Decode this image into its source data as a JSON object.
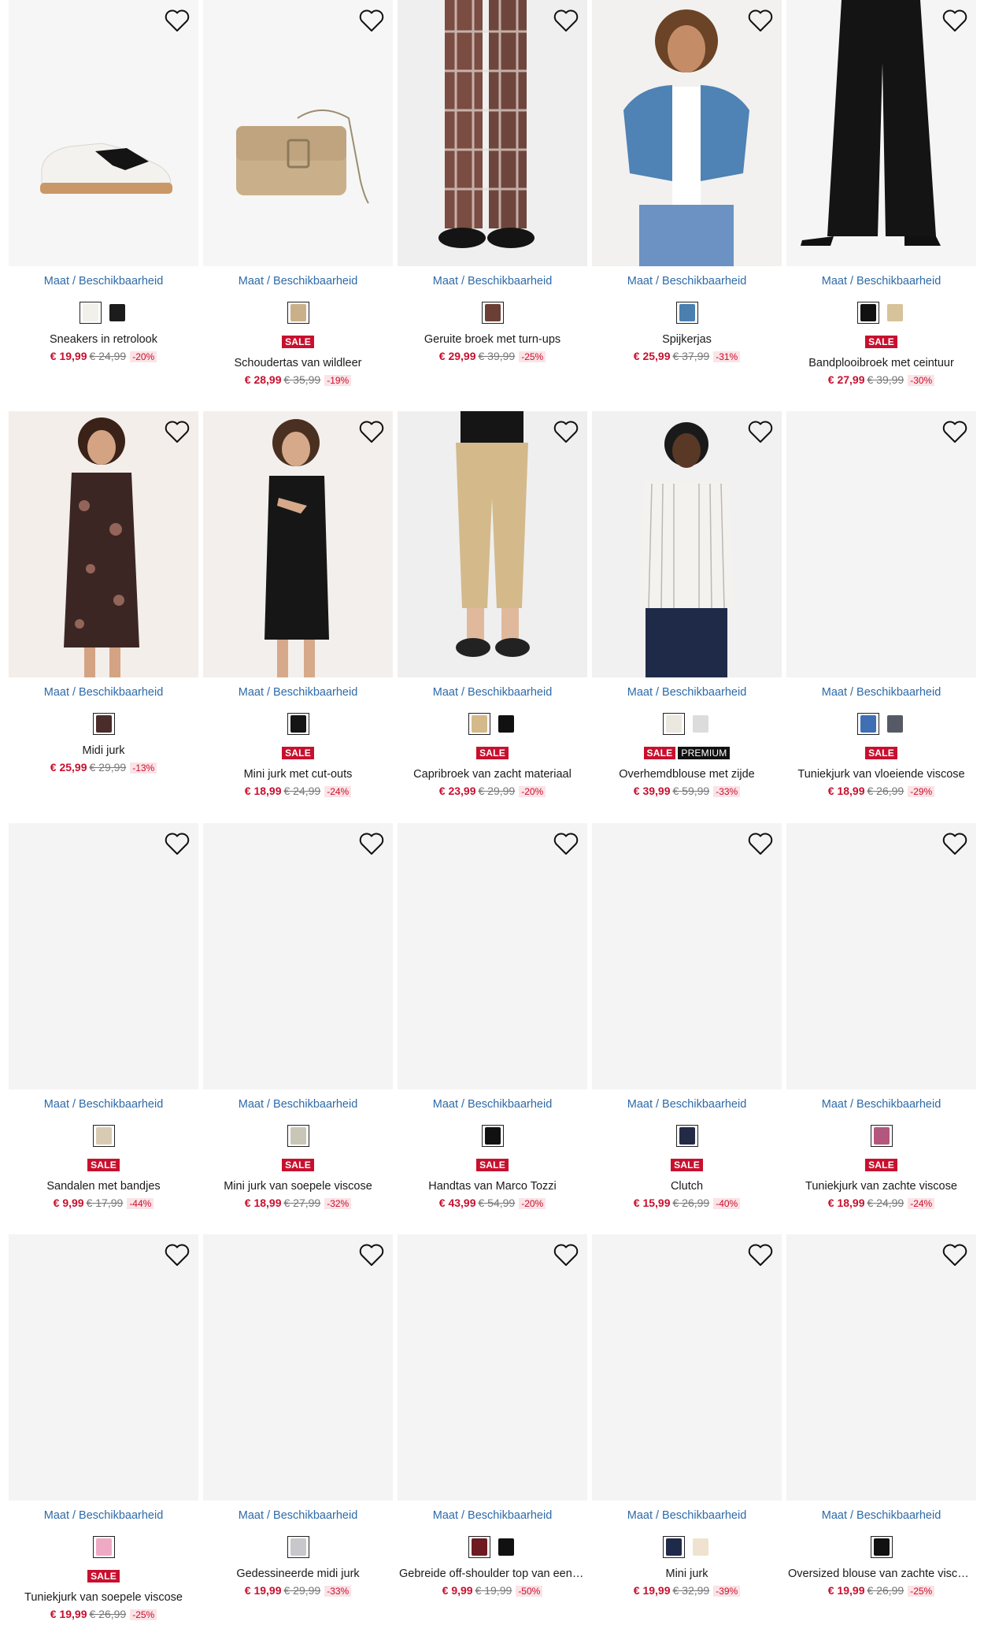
{
  "size_link_label": "Maat / Beschikbaarheid",
  "colors": {
    "price": "#c8102e",
    "link": "#2d6aa8",
    "sale_badge": "#c8102e",
    "premium_badge": "#111111",
    "image_bg": "#f4f4f4"
  },
  "products": [
    {
      "name": "Sneakers in retrolook",
      "price": "€ 19,99",
      "old_price": "€ 24,99",
      "discount": "-20%",
      "badges": [],
      "swatches": [
        "#f2f0ea",
        "#1c1c1c"
      ],
      "image": "sneaker"
    },
    {
      "name": "Schoudertas van wildleer",
      "price": "€ 28,99",
      "old_price": "€ 35,99",
      "discount": "-19%",
      "badges": [
        "SALE"
      ],
      "swatches": [
        "#c9b08b"
      ],
      "image": "bag"
    },
    {
      "name": "Geruite broek met turn-ups",
      "price": "€ 29,99",
      "old_price": "€ 39,99",
      "discount": "-25%",
      "badges": [],
      "swatches": [
        "#6b3f35"
      ],
      "image": "plaid"
    },
    {
      "name": "Spijkerjas",
      "price": "€ 25,99",
      "old_price": "€ 37,99",
      "discount": "-31%",
      "badges": [],
      "swatches": [
        "#4a7fb0"
      ],
      "image": "denim"
    },
    {
      "name": "Bandplooibroek met ceintuur",
      "price": "€ 27,99",
      "old_price": "€ 39,99",
      "discount": "-30%",
      "badges": [
        "SALE"
      ],
      "swatches": [
        "#111111",
        "#d8c29a"
      ],
      "image": "widepants"
    },
    {
      "name": "Midi jurk",
      "price": "€ 25,99",
      "old_price": "€ 29,99",
      "discount": "-13%",
      "badges": [],
      "swatches": [
        "#4a2c2a"
      ],
      "image": "printdress"
    },
    {
      "name": "Mini jurk met cut-outs",
      "price": "€ 18,99",
      "old_price": "€ 24,99",
      "discount": "-24%",
      "badges": [
        "SALE"
      ],
      "swatches": [
        "#151515"
      ],
      "image": "blackdress"
    },
    {
      "name": "Capribroek van zacht materiaal",
      "price": "€ 23,99",
      "old_price": "€ 29,99",
      "discount": "-20%",
      "badges": [
        "SALE"
      ],
      "swatches": [
        "#d4b98a",
        "#111111"
      ],
      "image": "capri"
    },
    {
      "name": "Overhemdblouse met zijde",
      "price": "€ 39,99",
      "old_price": "€ 59,99",
      "discount": "-33%",
      "badges": [
        "SALE",
        "PREMIUM"
      ],
      "swatches": [
        "#ece8e0",
        "#dcdcdc"
      ],
      "image": "shirt"
    },
    {
      "name": "Tuniekjurk van vloeiende viscose",
      "price": "€ 18,99",
      "old_price": "€ 26,99",
      "discount": "-29%",
      "badges": [
        "SALE"
      ],
      "swatches": [
        "#3f6fb5",
        "#555a66"
      ],
      "image": "blank"
    },
    {
      "name": "Sandalen met bandjes",
      "price": "€ 9,99",
      "old_price": "€ 17,99",
      "discount": "-44%",
      "badges": [
        "SALE"
      ],
      "swatches": [
        "#d9cbb3"
      ],
      "image": "blank"
    },
    {
      "name": "Mini jurk van soepele viscose",
      "price": "€ 18,99",
      "old_price": "€ 27,99",
      "discount": "-32%",
      "badges": [
        "SALE"
      ],
      "swatches": [
        "#c9c6b8"
      ],
      "image": "blank"
    },
    {
      "name": "Handtas van Marco Tozzi",
      "price": "€ 43,99",
      "old_price": "€ 54,99",
      "discount": "-20%",
      "badges": [
        "SALE"
      ],
      "swatches": [
        "#111111"
      ],
      "image": "blank"
    },
    {
      "name": "Clutch",
      "price": "€ 15,99",
      "old_price": "€ 26,99",
      "discount": "-40%",
      "badges": [
        "SALE"
      ],
      "swatches": [
        "#232a45"
      ],
      "image": "blank"
    },
    {
      "name": "Tuniekjurk van zachte viscose",
      "price": "€ 18,99",
      "old_price": "€ 24,99",
      "discount": "-24%",
      "badges": [
        "SALE"
      ],
      "swatches": [
        "#b4577e"
      ],
      "image": "blank"
    },
    {
      "name": "Tuniekjurk van soepele viscose",
      "price": "€ 19,99",
      "old_price": "€ 26,99",
      "discount": "-25%",
      "badges": [
        "SALE"
      ],
      "swatches": [
        "#f0a9c4"
      ],
      "image": "blank"
    },
    {
      "name": "Gedessineerde midi jurk",
      "price": "€ 19,99",
      "old_price": "€ 29,99",
      "discount": "-33%",
      "badges": [],
      "swatches": [
        "#c8c8cc"
      ],
      "image": "blank"
    },
    {
      "name": "Gebreide off-shoulder top van een …",
      "price": "€ 9,99",
      "old_price": "€ 19,99",
      "discount": "-50%",
      "badges": [],
      "swatches": [
        "#6d1a22",
        "#111111"
      ],
      "image": "blank"
    },
    {
      "name": "Mini jurk",
      "price": "€ 19,99",
      "old_price": "€ 32,99",
      "discount": "-39%",
      "badges": [],
      "swatches": [
        "#1f2a4a",
        "#efe3cf"
      ],
      "image": "blank"
    },
    {
      "name": "Oversized blouse van zachte viscose",
      "price": "€ 19,99",
      "old_price": "€ 26,99",
      "discount": "-25%",
      "badges": [],
      "swatches": [
        "#111111"
      ],
      "image": "blank"
    }
  ]
}
